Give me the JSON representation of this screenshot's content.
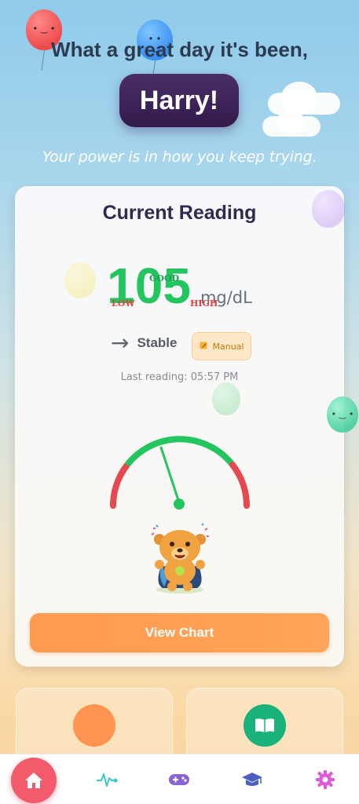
{
  "header": {
    "greeting": "What a great day it's been,",
    "name": "Harry!",
    "tagline": "Your power is in how you keep trying."
  },
  "reading_card": {
    "title": "Current Reading",
    "value": "105",
    "unit": "mg/dL",
    "trend_label": "Stable",
    "source_badge": "Manual",
    "last_reading": "Last reading: 05:57 PM",
    "gauge": {
      "low_label": "LOW",
      "good_label": "GOOD",
      "high_label": "HIGH"
    },
    "view_chart_label": "View Chart"
  },
  "nav": {
    "items": [
      "home",
      "activity",
      "games",
      "learn",
      "settings"
    ]
  },
  "colors": {
    "accent_green": "#22c55e",
    "accent_orange": "#ff9a4e",
    "accent_red": "#e53e3e",
    "name_pill": "#3b2357",
    "home_button": "#f35a6b"
  }
}
